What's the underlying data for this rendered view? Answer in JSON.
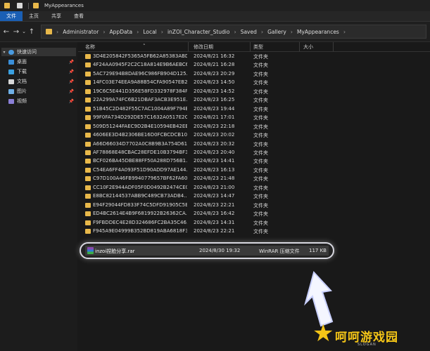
{
  "window": {
    "title": "MyAppearances"
  },
  "ribbon": {
    "tabs": [
      "文件",
      "主页",
      "共享",
      "查看"
    ]
  },
  "address": {
    "crumbs": [
      "Administrator",
      "AppData",
      "Local",
      "inZOI_Character_Studio",
      "Saved",
      "Gallery",
      "MyAppearances"
    ]
  },
  "sidebar": {
    "items": [
      {
        "label": "快速访问",
        "icon": "star-icon"
      },
      {
        "label": "桌面",
        "icon": "desktop-icon"
      },
      {
        "label": "下载",
        "icon": "download-icon"
      },
      {
        "label": "文档",
        "icon": "document-icon"
      },
      {
        "label": "图片",
        "icon": "picture-icon"
      },
      {
        "label": "视频",
        "icon": "video-icon"
      }
    ]
  },
  "columns": {
    "name": "名称",
    "date": "修改日期",
    "type": "类型",
    "size": "大小"
  },
  "rows": [
    {
      "name": "3D4E205842F5365A5FB62A85383ABD...",
      "date": "2024/8/21 16:32",
      "type": "文件夹"
    },
    {
      "name": "4F24AA0945F2C2C18A814E9B6AEBC6...",
      "date": "2024/8/21 16:28",
      "type": "文件夹"
    },
    {
      "name": "5AC729E94B8DAE96C986FB904D125...",
      "date": "2024/8/23 20:29",
      "type": "文件夹"
    },
    {
      "name": "14FC03E74EEA9A88B54CFA90547EB2...",
      "date": "2024/8/23 14:50",
      "type": "文件夹"
    },
    {
      "name": "19C6C5E441D356E58FD332978F384F...",
      "date": "2024/8/23 14:52",
      "type": "文件夹"
    },
    {
      "name": "22A299A74FC6B21DBAF3ACB3E951E...",
      "date": "2024/8/23 16:25",
      "type": "文件夹"
    },
    {
      "name": "51B45C2D482F55C7AC1004A89F794B...",
      "date": "2024/8/23 19:44",
      "type": "文件夹"
    },
    {
      "name": "99F0FA734D292DE57C1632A0517E2C...",
      "date": "2024/8/21 17:01",
      "type": "文件夹"
    },
    {
      "name": "509D51244FAEC9D2B4E10594EB42EE...",
      "date": "2024/8/23 22:18",
      "type": "文件夹"
    },
    {
      "name": "4606EE3D4B2306BE16D0FCBCDCB10...",
      "date": "2024/8/23 20:02",
      "type": "文件夹"
    },
    {
      "name": "A66D66034D7702A0C8B9B3A754D61...",
      "date": "2024/8/23 20:32",
      "type": "文件夹"
    },
    {
      "name": "AF78868E48CBAC28EFDE10B3794BF3...",
      "date": "2024/8/23 20:40",
      "type": "文件夹"
    },
    {
      "name": "BCF026BA45DBE88FF50A288D756B1...",
      "date": "2024/8/23 14:41",
      "type": "文件夹"
    },
    {
      "name": "C54EA6FF4A093F51D90ADD97AE144...",
      "date": "2024/8/23 16:13",
      "type": "文件夹"
    },
    {
      "name": "C97D100A46FB9940779657BF62FA60...",
      "date": "2024/8/23 21:48",
      "type": "文件夹"
    },
    {
      "name": "CC10F2E944ADF05F0D0492B2474CE0...",
      "date": "2024/8/23 21:00",
      "type": "文件夹"
    },
    {
      "name": "E8BC82144537ABB9C489CB73ADB4...",
      "date": "2024/8/23 14:47",
      "type": "文件夹"
    },
    {
      "name": "E94F29044FD833F74C5DFD91905C5B...",
      "date": "2024/8/23 22:21",
      "type": "文件夹"
    },
    {
      "name": "ED4BC2614E4B9F6819922B26362CA...",
      "date": "2024/8/23 16:42",
      "type": "文件夹"
    },
    {
      "name": "F9FBDDEC4E28D324686FC2BA35C46...",
      "date": "2024/8/23 14:31",
      "type": "文件夹"
    },
    {
      "name": "F945A9E04999B352BD819ABA6818F3...",
      "date": "2024/8/23 22:21",
      "type": "文件夹"
    }
  ],
  "selected_file": {
    "name": "inzoi捏脸分享.rar",
    "date": "2024/8/30 19:32",
    "type": "WinRAR 压缩文件",
    "size": "117 KB"
  },
  "watermark": {
    "brand": "呵呵游戏园",
    "slogan": "SLOGAN"
  },
  "colors": {
    "accent": "#1a5fb4",
    "folder": "#e8b84a",
    "logo": "#f3c417"
  }
}
